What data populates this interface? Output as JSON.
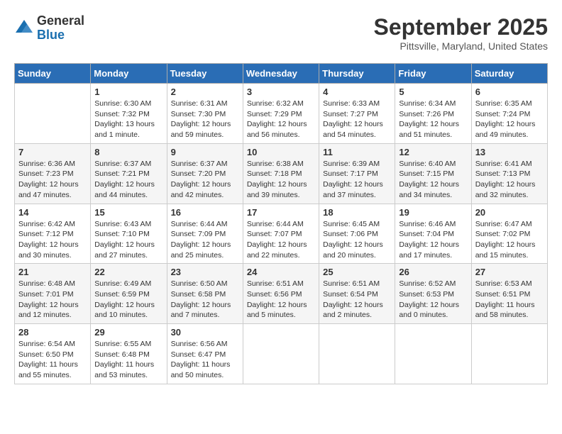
{
  "logo": {
    "general": "General",
    "blue": "Blue"
  },
  "title": "September 2025",
  "location": "Pittsville, Maryland, United States",
  "headers": [
    "Sunday",
    "Monday",
    "Tuesday",
    "Wednesday",
    "Thursday",
    "Friday",
    "Saturday"
  ],
  "weeks": [
    [
      {
        "day": "",
        "info": ""
      },
      {
        "day": "1",
        "info": "Sunrise: 6:30 AM\nSunset: 7:32 PM\nDaylight: 13 hours\nand 1 minute."
      },
      {
        "day": "2",
        "info": "Sunrise: 6:31 AM\nSunset: 7:30 PM\nDaylight: 12 hours\nand 59 minutes."
      },
      {
        "day": "3",
        "info": "Sunrise: 6:32 AM\nSunset: 7:29 PM\nDaylight: 12 hours\nand 56 minutes."
      },
      {
        "day": "4",
        "info": "Sunrise: 6:33 AM\nSunset: 7:27 PM\nDaylight: 12 hours\nand 54 minutes."
      },
      {
        "day": "5",
        "info": "Sunrise: 6:34 AM\nSunset: 7:26 PM\nDaylight: 12 hours\nand 51 minutes."
      },
      {
        "day": "6",
        "info": "Sunrise: 6:35 AM\nSunset: 7:24 PM\nDaylight: 12 hours\nand 49 minutes."
      }
    ],
    [
      {
        "day": "7",
        "info": "Sunrise: 6:36 AM\nSunset: 7:23 PM\nDaylight: 12 hours\nand 47 minutes."
      },
      {
        "day": "8",
        "info": "Sunrise: 6:37 AM\nSunset: 7:21 PM\nDaylight: 12 hours\nand 44 minutes."
      },
      {
        "day": "9",
        "info": "Sunrise: 6:37 AM\nSunset: 7:20 PM\nDaylight: 12 hours\nand 42 minutes."
      },
      {
        "day": "10",
        "info": "Sunrise: 6:38 AM\nSunset: 7:18 PM\nDaylight: 12 hours\nand 39 minutes."
      },
      {
        "day": "11",
        "info": "Sunrise: 6:39 AM\nSunset: 7:17 PM\nDaylight: 12 hours\nand 37 minutes."
      },
      {
        "day": "12",
        "info": "Sunrise: 6:40 AM\nSunset: 7:15 PM\nDaylight: 12 hours\nand 34 minutes."
      },
      {
        "day": "13",
        "info": "Sunrise: 6:41 AM\nSunset: 7:13 PM\nDaylight: 12 hours\nand 32 minutes."
      }
    ],
    [
      {
        "day": "14",
        "info": "Sunrise: 6:42 AM\nSunset: 7:12 PM\nDaylight: 12 hours\nand 30 minutes."
      },
      {
        "day": "15",
        "info": "Sunrise: 6:43 AM\nSunset: 7:10 PM\nDaylight: 12 hours\nand 27 minutes."
      },
      {
        "day": "16",
        "info": "Sunrise: 6:44 AM\nSunset: 7:09 PM\nDaylight: 12 hours\nand 25 minutes."
      },
      {
        "day": "17",
        "info": "Sunrise: 6:44 AM\nSunset: 7:07 PM\nDaylight: 12 hours\nand 22 minutes."
      },
      {
        "day": "18",
        "info": "Sunrise: 6:45 AM\nSunset: 7:06 PM\nDaylight: 12 hours\nand 20 minutes."
      },
      {
        "day": "19",
        "info": "Sunrise: 6:46 AM\nSunset: 7:04 PM\nDaylight: 12 hours\nand 17 minutes."
      },
      {
        "day": "20",
        "info": "Sunrise: 6:47 AM\nSunset: 7:02 PM\nDaylight: 12 hours\nand 15 minutes."
      }
    ],
    [
      {
        "day": "21",
        "info": "Sunrise: 6:48 AM\nSunset: 7:01 PM\nDaylight: 12 hours\nand 12 minutes."
      },
      {
        "day": "22",
        "info": "Sunrise: 6:49 AM\nSunset: 6:59 PM\nDaylight: 12 hours\nand 10 minutes."
      },
      {
        "day": "23",
        "info": "Sunrise: 6:50 AM\nSunset: 6:58 PM\nDaylight: 12 hours\nand 7 minutes."
      },
      {
        "day": "24",
        "info": "Sunrise: 6:51 AM\nSunset: 6:56 PM\nDaylight: 12 hours\nand 5 minutes."
      },
      {
        "day": "25",
        "info": "Sunrise: 6:51 AM\nSunset: 6:54 PM\nDaylight: 12 hours\nand 2 minutes."
      },
      {
        "day": "26",
        "info": "Sunrise: 6:52 AM\nSunset: 6:53 PM\nDaylight: 12 hours\nand 0 minutes."
      },
      {
        "day": "27",
        "info": "Sunrise: 6:53 AM\nSunset: 6:51 PM\nDaylight: 11 hours\nand 58 minutes."
      }
    ],
    [
      {
        "day": "28",
        "info": "Sunrise: 6:54 AM\nSunset: 6:50 PM\nDaylight: 11 hours\nand 55 minutes."
      },
      {
        "day": "29",
        "info": "Sunrise: 6:55 AM\nSunset: 6:48 PM\nDaylight: 11 hours\nand 53 minutes."
      },
      {
        "day": "30",
        "info": "Sunrise: 6:56 AM\nSunset: 6:47 PM\nDaylight: 11 hours\nand 50 minutes."
      },
      {
        "day": "",
        "info": ""
      },
      {
        "day": "",
        "info": ""
      },
      {
        "day": "",
        "info": ""
      },
      {
        "day": "",
        "info": ""
      }
    ]
  ]
}
